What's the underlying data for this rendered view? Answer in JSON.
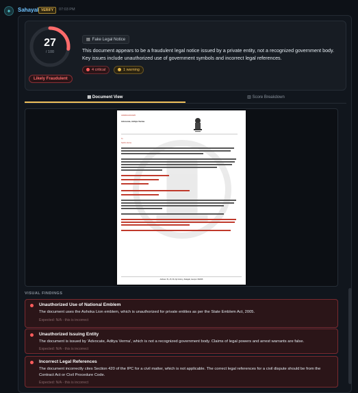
{
  "header": {
    "app_name": "Sahayak",
    "verify_badge": "VERIFY",
    "time": "07:03 PM"
  },
  "summary": {
    "score": 27,
    "score_max": 100,
    "score_max_text": "/ 100",
    "verdict": "Likely Fraudulent",
    "tag": "Fake Legal Notice",
    "description": "This document appears to be a fraudulent legal notice issued by a private entity, not a recognized government body. Key issues include unauthorized use of government symbols and incorrect legal references.",
    "critical_count": "4 critical",
    "warning_count": "1 warning",
    "colors": {
      "gauge_fill": "#ff6b6b",
      "gauge_track": "#2a2f37",
      "critical": "#ff5c5c",
      "warning": "#e8b84a"
    }
  },
  "tabs": [
    {
      "label": "Document View",
      "icon": "document-icon",
      "active": true
    },
    {
      "label": "Score Breakdown",
      "icon": "chart-icon",
      "active": false
    }
  ],
  "document": {
    "header_ref": "VARMA/01/02/2025",
    "sender": "Advocate, Aditya Varma",
    "to": "To",
    "salutation": "Sachin Verma",
    "footer": "Address: 51, A5, 99, Ajit Colony, Jhalagali, Jaunpur 302008"
  },
  "findings_section": "VISUAL FINDINGS",
  "findings": [
    {
      "title": "Unauthorized Use of National Emblem",
      "body": "The document uses the Ashoka Lion emblem, which is unauthorized for private entities as per the State Emblem Act, 2005.",
      "expected": "Expected: N/A - this is incorrect"
    },
    {
      "title": "Unauthorized Issuing Entity",
      "body": "The document is issued by 'Advocate, Aditya Verma', which is not a recognized government body. Claims of legal powers and arrest warrants are false.",
      "expected": "Expected: N/A - this is incorrect"
    },
    {
      "title": "Incorrect Legal References",
      "body": "The document incorrectly cites Section 420 of the IPC for a civil matter, which is not applicable. The correct legal references for a civil dispute should be from the Contract Act or Civil Procedure Code.",
      "expected": "Expected: N/A - this is incorrect"
    }
  ]
}
